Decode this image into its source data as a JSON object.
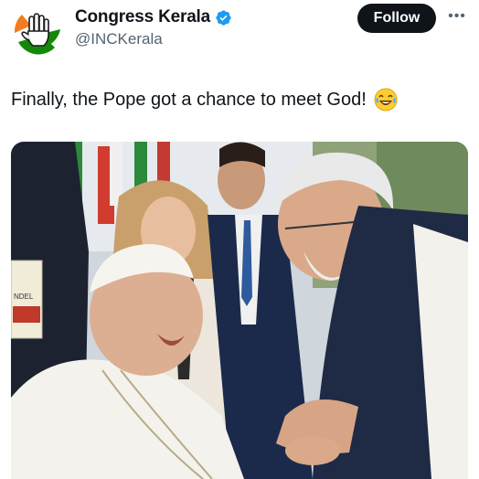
{
  "post": {
    "author": {
      "display_name": "Congress Kerala",
      "handle": "@INCKerala",
      "verified": true,
      "avatar_icon": "hand-symbol-logo"
    },
    "follow_label": "Follow",
    "more_label": "•••",
    "text": "Finally, the Pope got a chance to meet God!",
    "emoji_icon": "laughing-tears-emoji",
    "media": {
      "description_icon": "photo",
      "badge_text": "NDEL"
    }
  },
  "colors": {
    "text_primary": "#0f1419",
    "text_secondary": "#536471",
    "verified_blue": "#1d9bf0",
    "follow_bg": "#0f1419",
    "saffron": "#f47b20",
    "green": "#138808"
  }
}
